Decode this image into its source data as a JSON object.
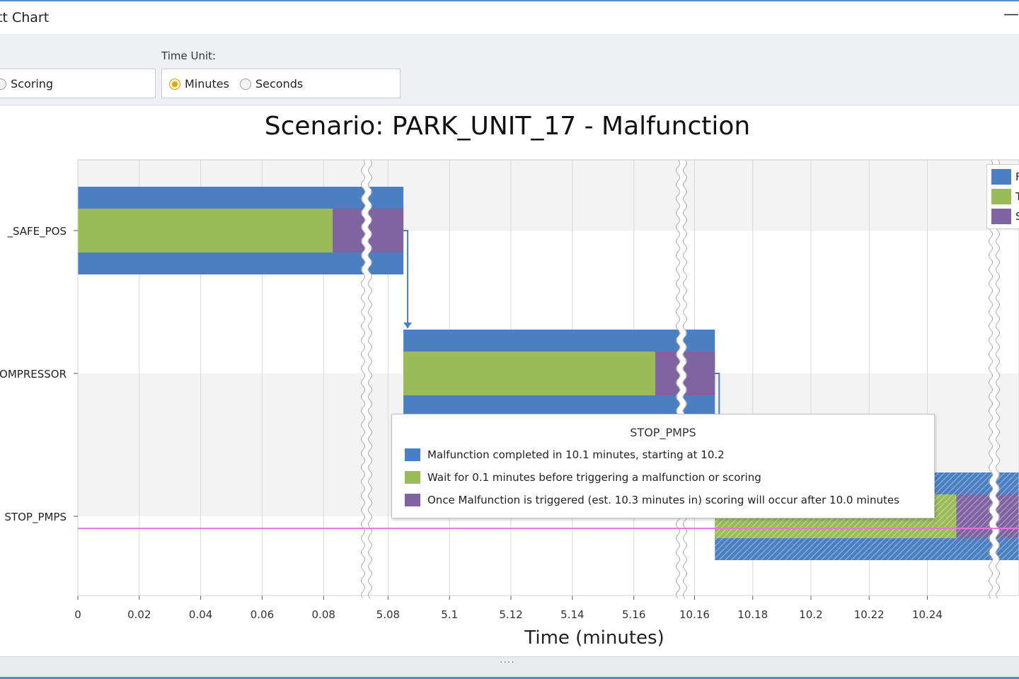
{
  "window": {
    "title": "tt Chart",
    "minimize_glyph": "—"
  },
  "toolbar": {
    "time_unit_label": "Time Unit:",
    "scoring_label": "Scoring",
    "minutes_label": "Minutes",
    "seconds_label": "Seconds",
    "selected_unit": "Minutes"
  },
  "colors": {
    "run": "#4a7fc1",
    "wait": "#9bbb59",
    "scoring": "#8064a2",
    "marker_line": "#e07ad8",
    "band": "#f3f3f3"
  },
  "tooltip": {
    "title": "STOP_PMPS",
    "rows": [
      {
        "color": "#4a7fc1",
        "text": "Malfunction completed in 10.1 minutes, starting at 10.2"
      },
      {
        "color": "#9bbb59",
        "text": "Wait for 0.1 minutes before triggering a malfunction or scoring"
      },
      {
        "color": "#8064a2",
        "text": "Once Malfunction is triggered (est. 10.3 minutes in) scoring will occur after 10.0 minutes"
      }
    ]
  },
  "legend": {
    "items": [
      {
        "color": "#4a7fc1",
        "text": "F"
      },
      {
        "color": "#9bbb59",
        "text": "T"
      },
      {
        "color": "#8064a2",
        "text": "S"
      }
    ]
  },
  "chart_data": {
    "type": "gantt",
    "title": "Scenario: PARK_UNIT_17 - Malfunction",
    "xlabel": "Time (minutes)",
    "ylabel": "",
    "categories": [
      "_SAFE_POS",
      "OMPRESSOR",
      "STOP_PMPS"
    ],
    "axis_segments": [
      {
        "range": [
          0,
          0.094
        ],
        "ticks": [
          0,
          0.02,
          0.04,
          0.06,
          0.08
        ]
      },
      {
        "range": [
          5.073,
          5.1755
        ],
        "ticks": [
          5.08,
          5.1,
          5.12,
          5.14,
          5.16
        ]
      },
      {
        "range": [
          10.1555,
          10.263
        ],
        "ticks": [
          10.16,
          10.18,
          10.2,
          10.22,
          10.24
        ]
      }
    ],
    "tasks": [
      {
        "category": "_SAFE_POS",
        "start": 0,
        "end": 5.085,
        "wait_end": 0.083,
        "scoring_end": 5.085
      },
      {
        "category": "OMPRESSOR",
        "start": 5.085,
        "end": 10.167,
        "wait_end": 5.167,
        "scoring_end": 10.167
      },
      {
        "category": "STOP_PMPS",
        "start": 10.167,
        "end": 10.275,
        "wait_end": 10.25,
        "scoring_end": 10.275,
        "hatched": true
      }
    ],
    "dependencies": [
      {
        "from": "_SAFE_POS",
        "to": "OMPRESSOR"
      },
      {
        "from": "OMPRESSOR",
        "to": "STOP_PMPS"
      }
    ],
    "marker_line_category_offset": 0.085,
    "grid": true,
    "legend_position": "top-right"
  }
}
